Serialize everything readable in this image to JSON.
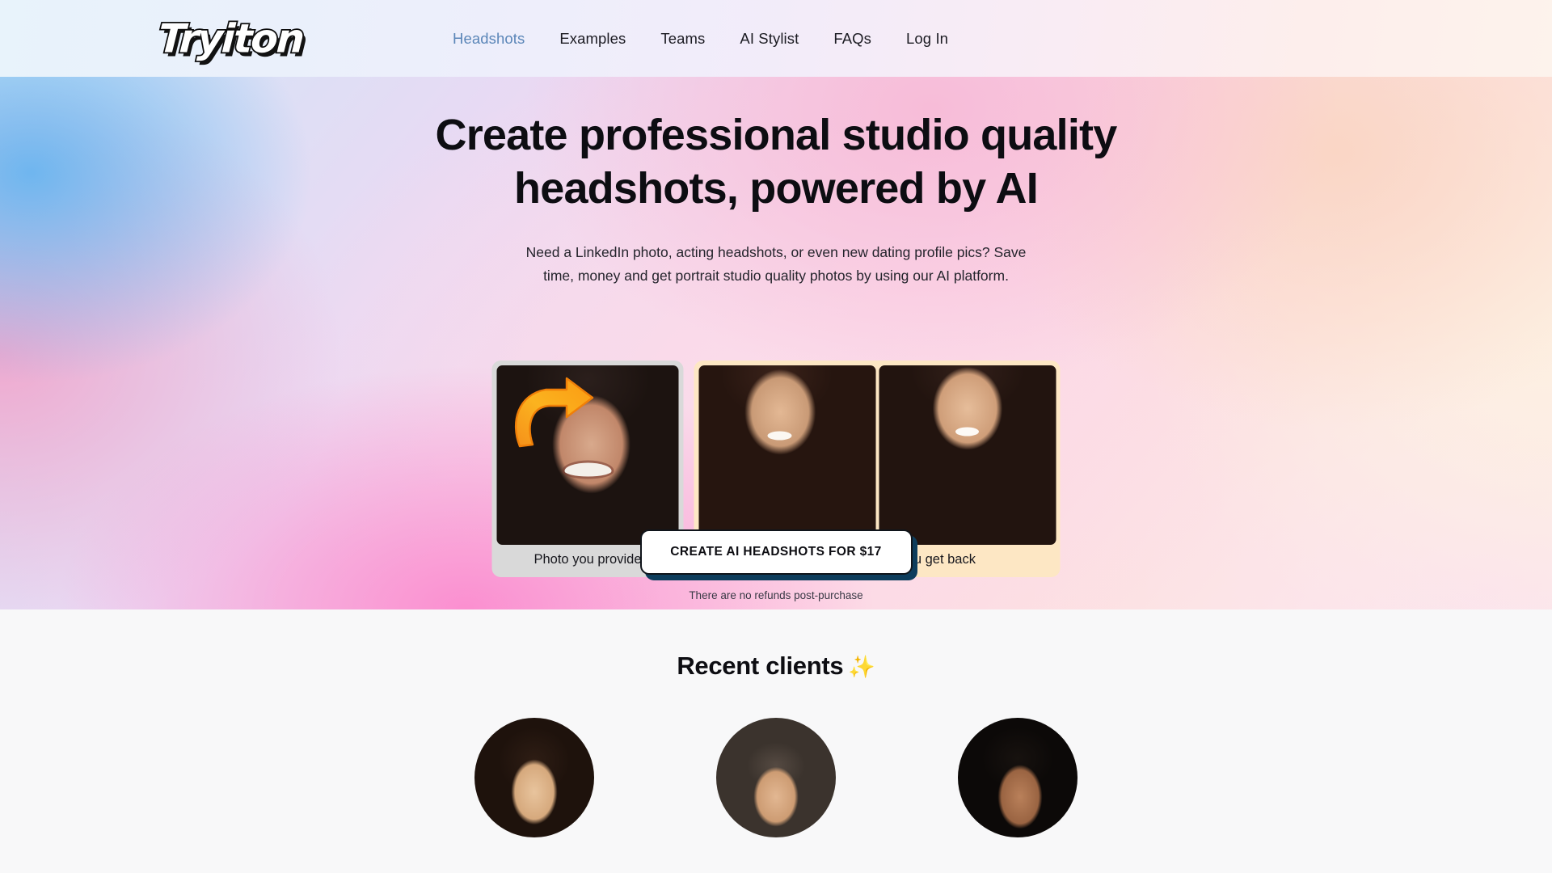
{
  "header": {
    "logo_text": "Tryiton",
    "nav": [
      {
        "label": "Headshots",
        "active": true
      },
      {
        "label": "Examples",
        "active": false
      },
      {
        "label": "Teams",
        "active": false
      },
      {
        "label": "AI Stylist",
        "active": false
      },
      {
        "label": "FAQs",
        "active": false
      },
      {
        "label": "Log In",
        "active": false
      }
    ]
  },
  "hero": {
    "title": "Create professional studio quality headshots, powered by AI",
    "subtitle": "Need a LinkedIn photo, acting headshots, or even new dating profile pics? Save time, money and get portrait studio quality photos by using our AI platform.",
    "compare": {
      "before_caption": "Photo you provide",
      "after_caption": "Headshot examples you get back",
      "arrow_icon": "curved-arrow-right-icon",
      "arrow_color": "#f99a16"
    },
    "cta": {
      "label": "CREATE AI HEADSHOTS FOR $17",
      "note": "There are no refunds post-purchase",
      "shadow_color": "#0d3d5c"
    }
  },
  "clients": {
    "title": "Recent clients",
    "sparkle_icon": "✨",
    "avatars": [
      {
        "name": "client-avatar-1"
      },
      {
        "name": "client-avatar-2"
      },
      {
        "name": "client-avatar-3"
      }
    ]
  },
  "colors": {
    "nav_active": "#5b86b8",
    "text_dark": "#0d0d12",
    "card_before_bg": "#d9d9d9",
    "card_after_bg": "#fde7c4",
    "clients_bg": "#f8f8f9"
  }
}
